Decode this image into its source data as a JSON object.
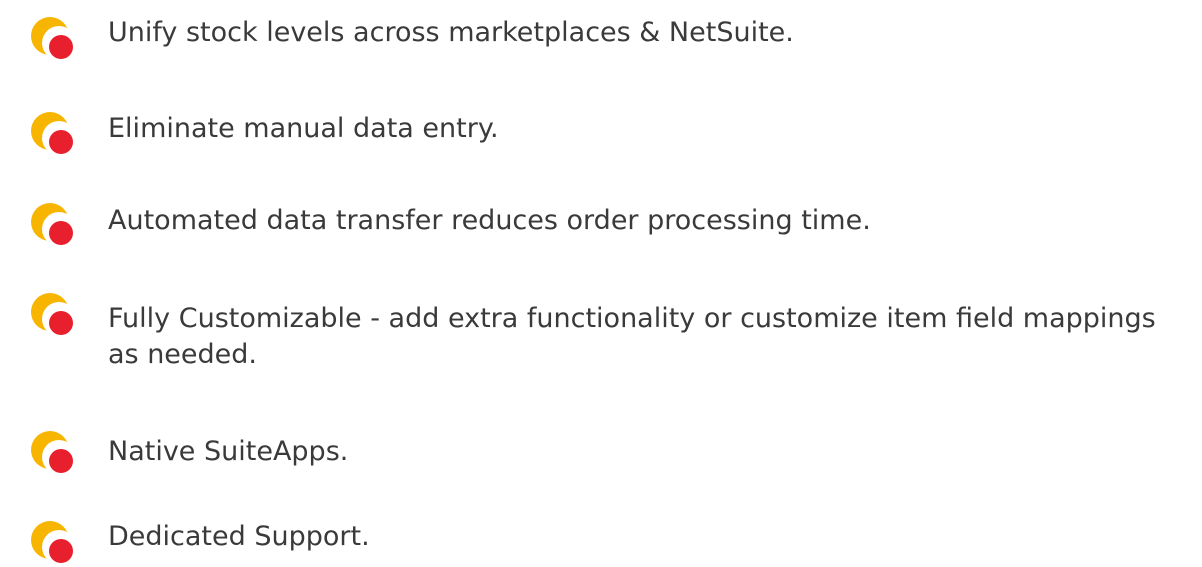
{
  "features": [
    {
      "text": "Unify stock levels across marketplaces & NetSuite.",
      "icon": "crescent-dot-bullet-icon"
    },
    {
      "text": "Eliminate manual data entry.",
      "icon": "crescent-dot-bullet-icon"
    },
    {
      "text": "Automated data transfer reduces order processing time.",
      "icon": "crescent-dot-bullet-icon"
    },
    {
      "text": "Fully Customizable - add extra functionality or customize item field mappings as needed.",
      "icon": "crescent-dot-bullet-icon"
    },
    {
      "text": "Native SuiteApps.",
      "icon": "crescent-dot-bullet-icon"
    },
    {
      "text": "Dedicated Support.",
      "icon": "crescent-dot-bullet-icon"
    }
  ],
  "colors": {
    "text": "#3a3a3a",
    "bullet_crescent": "#f7b500",
    "bullet_dot": "#e8202d"
  }
}
